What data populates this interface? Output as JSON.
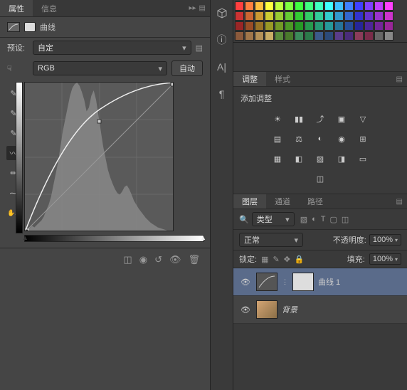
{
  "tabs": {
    "properties": "属性",
    "info": "信息"
  },
  "curves_title": "曲线",
  "preset": {
    "label": "预设:",
    "value": "自定"
  },
  "channel": {
    "value": "RGB",
    "auto": "自动"
  },
  "chart_data": {
    "type": "line",
    "title": "曲线",
    "xlabel": "",
    "ylabel": "",
    "xlim": [
      0,
      255
    ],
    "ylim": [
      0,
      255
    ],
    "series": [
      {
        "name": "curve",
        "values": [
          [
            0,
            0
          ],
          [
            64,
            110
          ],
          [
            128,
            190
          ],
          [
            192,
            235
          ],
          [
            255,
            255
          ]
        ]
      },
      {
        "name": "baseline",
        "values": [
          [
            0,
            0
          ],
          [
            255,
            255
          ]
        ]
      }
    ],
    "histogram": [
      2,
      3,
      5,
      8,
      6,
      9,
      12,
      15,
      20,
      28,
      35,
      45,
      60,
      75,
      90,
      110,
      130,
      145,
      160,
      175,
      185,
      190,
      192,
      188,
      180,
      170,
      155,
      160,
      175,
      182,
      170,
      150,
      130,
      110,
      95,
      80,
      70,
      62,
      55,
      50,
      48,
      52,
      58,
      60,
      55,
      48,
      40,
      35,
      30,
      26,
      22,
      18,
      15,
      12,
      10,
      8,
      6,
      5,
      4,
      3,
      2,
      2,
      1,
      1
    ]
  },
  "mid": {
    "cube": "⬚",
    "info": "ⓘ",
    "char": "A|",
    "para": "¶"
  },
  "adjustments": {
    "tab1": "调整",
    "tab2": "样式",
    "title": "添加调整"
  },
  "layers": {
    "tab1": "图层",
    "tab2": "通道",
    "tab3": "路径",
    "kind": "类型",
    "blend": "正常",
    "opacity_label": "不透明度:",
    "opacity": "100%",
    "lock_label": "锁定:",
    "fill_label": "填充:",
    "fill": "100%",
    "items": [
      {
        "name": "曲线 1",
        "type": "adjustment"
      },
      {
        "name": "背景",
        "type": "image"
      }
    ]
  },
  "swatch_colors": [
    "#ff4040",
    "#ff8040",
    "#ffc040",
    "#ffff40",
    "#c0ff40",
    "#80ff40",
    "#40ff40",
    "#40ff80",
    "#40ffc0",
    "#40ffff",
    "#40c0ff",
    "#4080ff",
    "#4040ff",
    "#8040ff",
    "#c040ff",
    "#ff40ff",
    "#cc3333",
    "#cc6633",
    "#cc9933",
    "#cccc33",
    "#99cc33",
    "#66cc33",
    "#33cc33",
    "#33cc66",
    "#33cc99",
    "#33cccc",
    "#3399cc",
    "#3366cc",
    "#3333cc",
    "#6633cc",
    "#9933cc",
    "#cc33cc",
    "#992626",
    "#994d26",
    "#997326",
    "#999926",
    "#739926",
    "#4d9926",
    "#269926",
    "#26994d",
    "#269973",
    "#269999",
    "#267399",
    "#264d99",
    "#262699",
    "#4d2699",
    "#732699",
    "#992699",
    "#8b5a3c",
    "#a0764a",
    "#b59158",
    "#caad66",
    "#5a8b3c",
    "#4a7a2c",
    "#3c8b5a",
    "#2c7a4a",
    "#3c5a8b",
    "#2c4a7a",
    "#5a3c8b",
    "#4a2c7a",
    "#8b3c5a",
    "#7a2c4a",
    "#666666",
    "#888888"
  ]
}
